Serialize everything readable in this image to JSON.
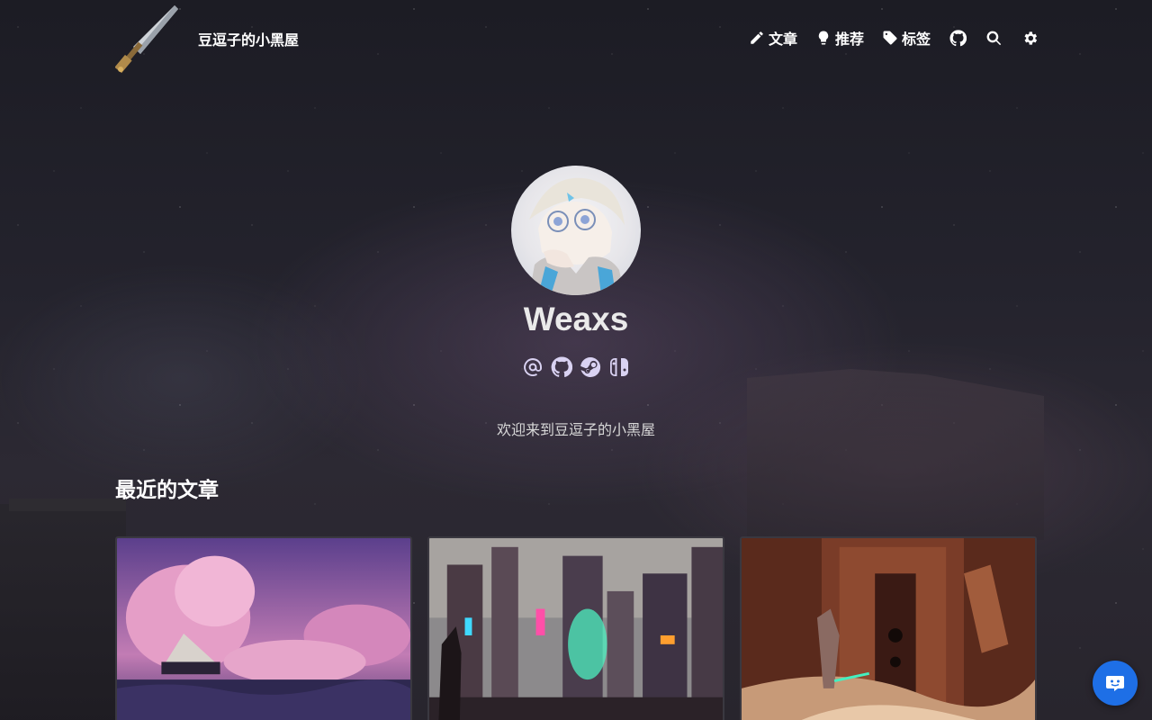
{
  "header": {
    "site_title": "豆逗子的小黑屋",
    "nav": {
      "articles": "文章",
      "recommend": "推荐",
      "tags": "标签"
    },
    "icons": [
      "pencil-icon",
      "lightbulb-icon",
      "tag-icon",
      "github-icon",
      "search-icon",
      "gear-icon"
    ]
  },
  "profile": {
    "name": "Weaxs",
    "social_icons": [
      "at-icon",
      "github-icon",
      "steam-icon",
      "switch-icon"
    ],
    "tagline": "欢迎来到豆逗子的小黑屋"
  },
  "recent": {
    "title": "最近的文章"
  },
  "colors": {
    "background": "#24232d",
    "social_icon": "#d9d2f2",
    "chat_button": "#1e6fe6"
  }
}
